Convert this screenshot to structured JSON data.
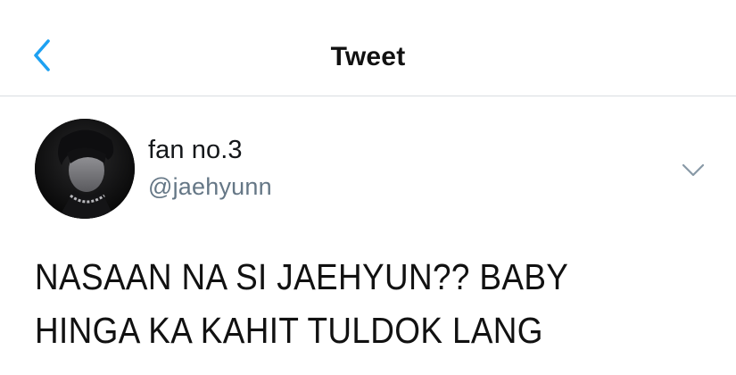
{
  "header": {
    "title": "Tweet",
    "back_icon": "chevron-left-icon",
    "accent_color": "#1da1f2"
  },
  "tweet": {
    "author": {
      "display_name": "fan no.3",
      "handle": "@jaehyunn"
    },
    "menu_icon": "chevron-down-icon",
    "text_lines": [
      "NASAAN NA SI JAEHYUN?? BABY",
      "HINGA KA KAHIT TULDOK LANG"
    ]
  }
}
